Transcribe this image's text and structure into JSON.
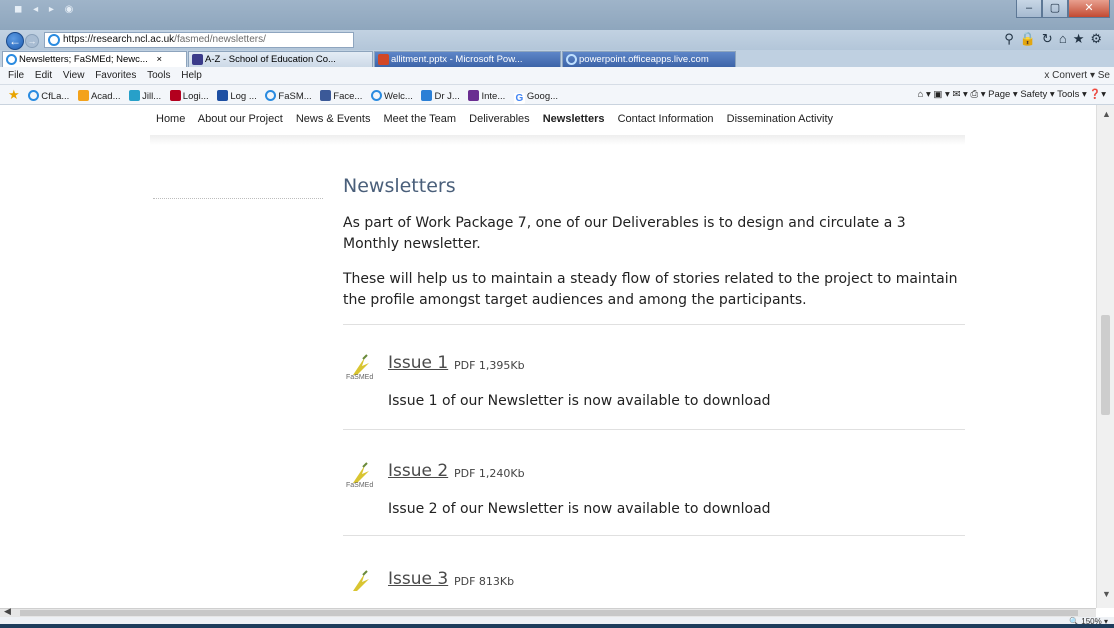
{
  "browser": {
    "url_host": "https://research.ncl.ac.uk",
    "url_path": "/fasmed/newsletters/",
    "tabs": [
      {
        "label": "Newsletters; FaSMEd; Newc...",
        "close": "×"
      },
      {
        "label": "A-Z - School of Education Co..."
      },
      {
        "label": "allitment.pptx - Microsoft Pow..."
      },
      {
        "label": "powerpoint.officeapps.live.com"
      }
    ],
    "menu": [
      "File",
      "Edit",
      "View",
      "Favorites",
      "Tools",
      "Help"
    ],
    "menu_right": "x  Convert ▾  Se",
    "favorites": [
      "CfLa...",
      "Acad...",
      "Jill...",
      "Logi...",
      "Log ...",
      "FaSM...",
      "Face...",
      "Welc...",
      "Dr J...",
      "Inte...",
      "Goog..."
    ],
    "command_bar": "Page ▾  Safety ▾  Tools ▾",
    "zoom": "150%"
  },
  "site_nav": {
    "items": [
      "Home",
      "About our Project",
      "News & Events",
      "Meet the Team",
      "Deliverables",
      "Newsletters",
      "Contact Information",
      "Dissemination Activity"
    ],
    "current": "Newsletters"
  },
  "page": {
    "title": "Newsletters",
    "intro_1": "As part of Work Package 7, one of our Deliverables is to design and circulate a 3 Monthly newsletter.",
    "intro_2": "These will help us to maintain a steady flow of stories related to the project to maintain the profile amongst target audiences and among the participants."
  },
  "issues": [
    {
      "title": "Issue 1",
      "meta": "PDF 1,395Kb",
      "desc": "Issue 1 of our Newsletter is now available to download",
      "logo": "FaSMEd"
    },
    {
      "title": "Issue 2",
      "meta": "PDF 1,240Kb",
      "desc": "Issue 2 of our Newsletter is now available to download",
      "logo": "FaSMEd"
    },
    {
      "title": "Issue 3",
      "meta": "PDF 813Kb",
      "desc": "",
      "logo": "FaSMEd"
    }
  ],
  "colors": {
    "title_blue": "#4a5f7a",
    "ie_blue": "#2a8be0"
  }
}
